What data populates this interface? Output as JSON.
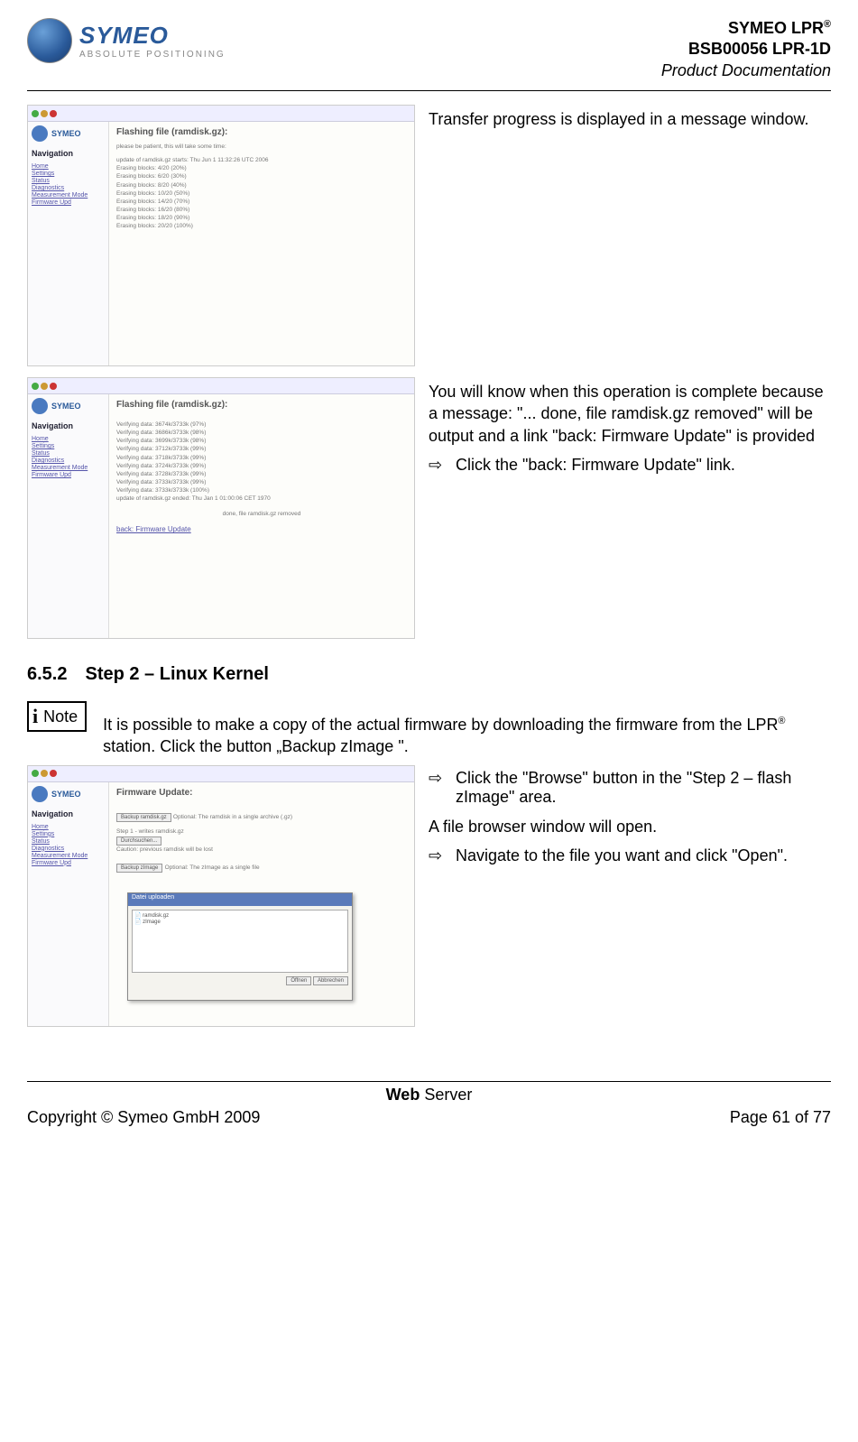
{
  "header": {
    "company": "SYMEO",
    "tagline": "ABSOLUTE POSITIONING",
    "doc_line1_pre": "SYMEO LPR",
    "doc_line1_sup": "®",
    "doc_line2": "BSB00056 LPR-1D",
    "doc_line3": "Product Documentation"
  },
  "row1": {
    "shot": {
      "nav_title": "Navigation",
      "page_title": "Flashing file (ramdisk.gz):",
      "msg": "please be patient, this will take some time:",
      "up_line": "update of ramdisk.gz starts: Thu Jun 1 11:32:26 UTC 2006",
      "lines": [
        "Erasing blocks: 4/20 (20%)",
        "Erasing blocks: 6/20 (30%)",
        "Erasing blocks: 8/20 (40%)",
        "Erasing blocks: 10/20 (50%)",
        "Erasing blocks: 14/20 (70%)",
        "Erasing blocks: 16/20 (80%)",
        "Erasing blocks: 18/20 (90%)",
        "Erasing blocks: 20/20 (100%)"
      ],
      "nav": [
        "Home",
        "Settings",
        "Status",
        "Diagnostics",
        "Measurement Mode",
        "Firmware Upd"
      ]
    },
    "text": "Transfer progress is displayed in a message window."
  },
  "row2": {
    "shot": {
      "nav_title": "Navigation",
      "page_title": "Flashing file (ramdisk.gz):",
      "lines": [
        "Verifying data: 3674k/3733k (97%)",
        "Verifying data: 3686k/3733k (98%)",
        "Verifying data: 3699k/3733k (98%)",
        "Verifying data: 3712k/3733k (99%)",
        "Verifying data: 3718k/3733k (99%)",
        "Verifying data: 3724k/3733k (99%)",
        "Verifying data: 3728k/3733k (99%)",
        "Verifying data: 3733k/3733k (99%)",
        "Verifying data: 3733k/3733k (100%)",
        "update of ramdisk.gz ended: Thu Jan 1 01:00:06 CET 1970"
      ],
      "done": "done, file ramdisk.gz removed",
      "back": "back: Firmware Update",
      "nav": [
        "Home",
        "Settings",
        "Status",
        "Diagnostics",
        "Measurement Mode",
        "Firmware Upd"
      ]
    },
    "text": "You will know when this operation is complete because a message: \"...  done, file ramdisk.gz removed\" will be output and a link \"back: Firmware Update\" is provided",
    "action": "Click the \"back: Firmware Update\" link."
  },
  "section": {
    "num": "6.5.2",
    "title": "Step 2 – Linux Kernel"
  },
  "note": {
    "label": "Note",
    "text_pre": "It is possible to make a copy of the actual firmware by downloading the firmware from the LPR",
    "sup": "®",
    "text_post": " station. Click the button „Backup zImage \"."
  },
  "row3": {
    "shot": {
      "nav_title": "Navigation",
      "page_title": "Firmware Update:",
      "step1_label": "Step 1 - writes ramdisk.gz",
      "btn_backup1": "Backup ramdisk.gz",
      "btn_browse": "Durchsuchen...",
      "note1": "Optional: The ramdisk in a single archive (.gz)",
      "note2": "Caution: previous ramdisk will be lost",
      "btn_backup2": "Backup zImage",
      "note3": "Optional: The zImage as a single file",
      "dlg_title": "Datei uploaden",
      "nav": [
        "Home",
        "Settings",
        "Status",
        "Diagnostics",
        "Measurement Mode",
        "Firmware Upd"
      ]
    },
    "action1": "Click the \"Browse\" button in the \"Step 2 – flash zImage\" area.",
    "text": "A file browser window will open.",
    "action2": "Navigate to the file you want and click \"Open\"."
  },
  "footer": {
    "center_bold": "Web",
    "center_rest": " Server",
    "copyright": "Copyright © Symeo GmbH 2009",
    "page": "Page 61 of 77"
  }
}
